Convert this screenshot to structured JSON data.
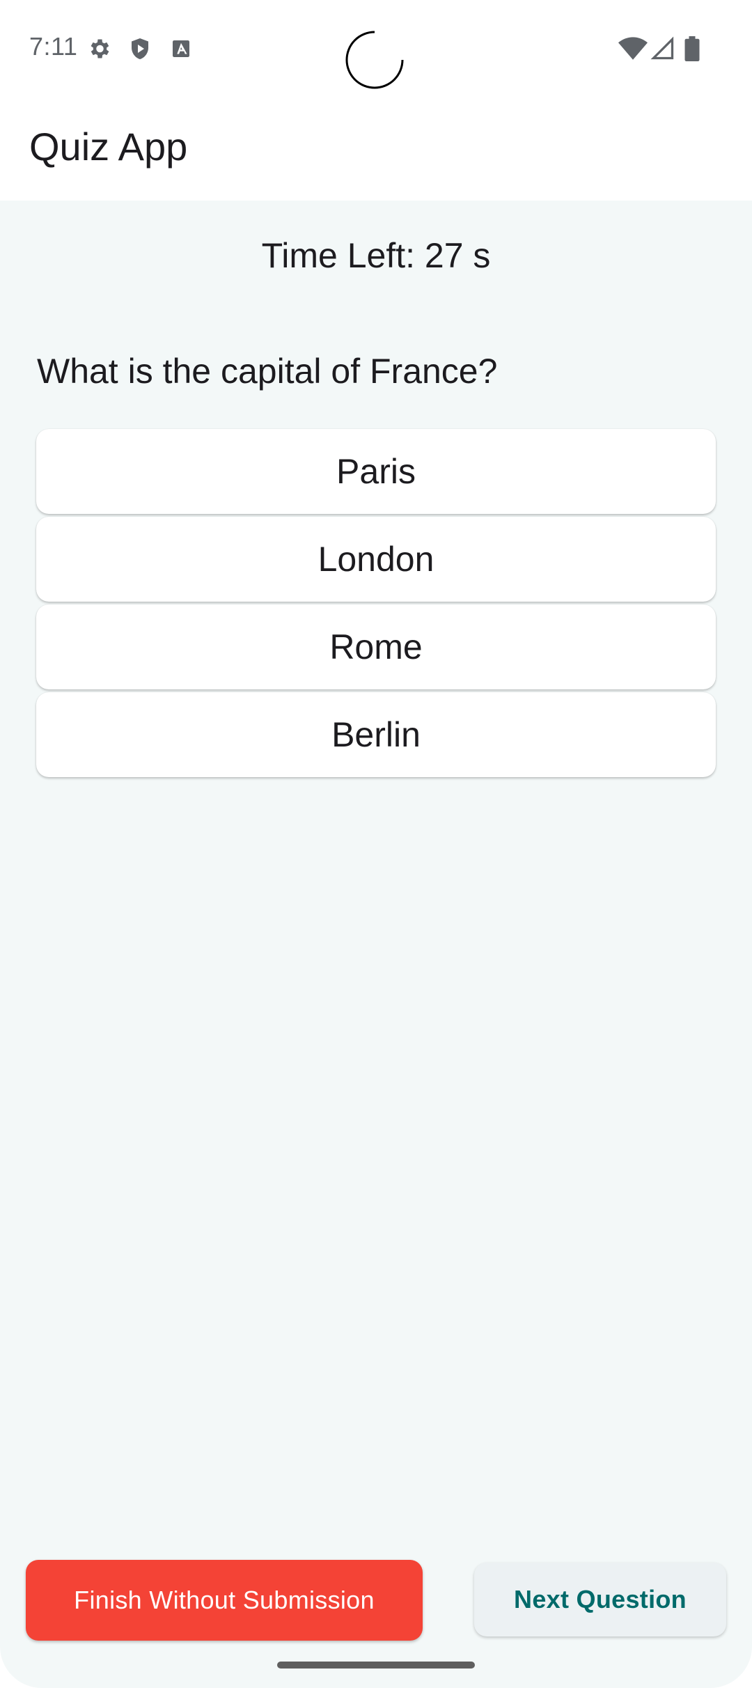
{
  "status_bar": {
    "time": "7:11",
    "left_icons": [
      "settings-gear-icon",
      "shield-play-icon",
      "keyboard-a-icon"
    ],
    "right_icons": [
      "wifi-icon",
      "cellular-signal-icon",
      "battery-icon"
    ]
  },
  "app_bar": {
    "title": "Quiz App"
  },
  "quiz": {
    "timer_text": "Time Left: 27 s",
    "question": "What is the capital of France?",
    "options": [
      {
        "label": "Paris"
      },
      {
        "label": "London"
      },
      {
        "label": "Rome"
      },
      {
        "label": "Berlin"
      }
    ]
  },
  "actions": {
    "finish_label": "Finish Without Submission",
    "next_label": "Next Question"
  },
  "colors": {
    "background": "#f3f8f8",
    "finish_button": "#f44336",
    "next_button_text": "#006a6a",
    "next_button_bg": "#ecf1f3"
  }
}
